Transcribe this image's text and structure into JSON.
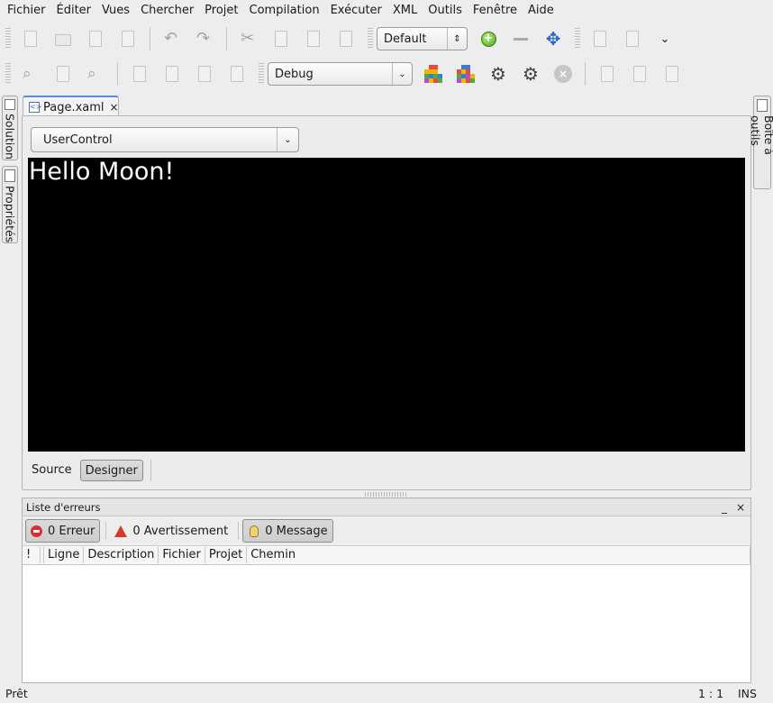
{
  "menubar": {
    "items": [
      "Fichier",
      "Éditer",
      "Vues",
      "Chercher",
      "Projet",
      "Compilation",
      "Exécuter",
      "XML",
      "Outils",
      "Fenêtre",
      "Aide"
    ]
  },
  "toolbar": {
    "layout_combo": "Default",
    "config_combo": "Debug"
  },
  "side_pads": {
    "solution": "Solution",
    "properties": "Propriétés",
    "toolbox": "Boîte à outils"
  },
  "document": {
    "tab_label": "Page.xaml",
    "tab_close": "×",
    "element_combo": "UserControl",
    "canvas_text": "Hello Moon!",
    "view_tabs": [
      "Source",
      "Designer"
    ]
  },
  "errors": {
    "title": "Liste d'erreurs",
    "minimize": "_",
    "close": "×",
    "error_btn": "0 Erreur",
    "warning_btn": "0 Avertissement",
    "message_btn": "0 Message",
    "columns": [
      "!",
      "Ligne",
      "Description",
      "Fichier",
      "Projet",
      "Chemin"
    ]
  },
  "statusbar": {
    "text": "Prêt",
    "position": "1 : 1",
    "mode": "INS"
  },
  "colors": {
    "canvas_bg": "#000000",
    "tab_accent": "#5a8fd8",
    "error_red": "#d9302f"
  }
}
